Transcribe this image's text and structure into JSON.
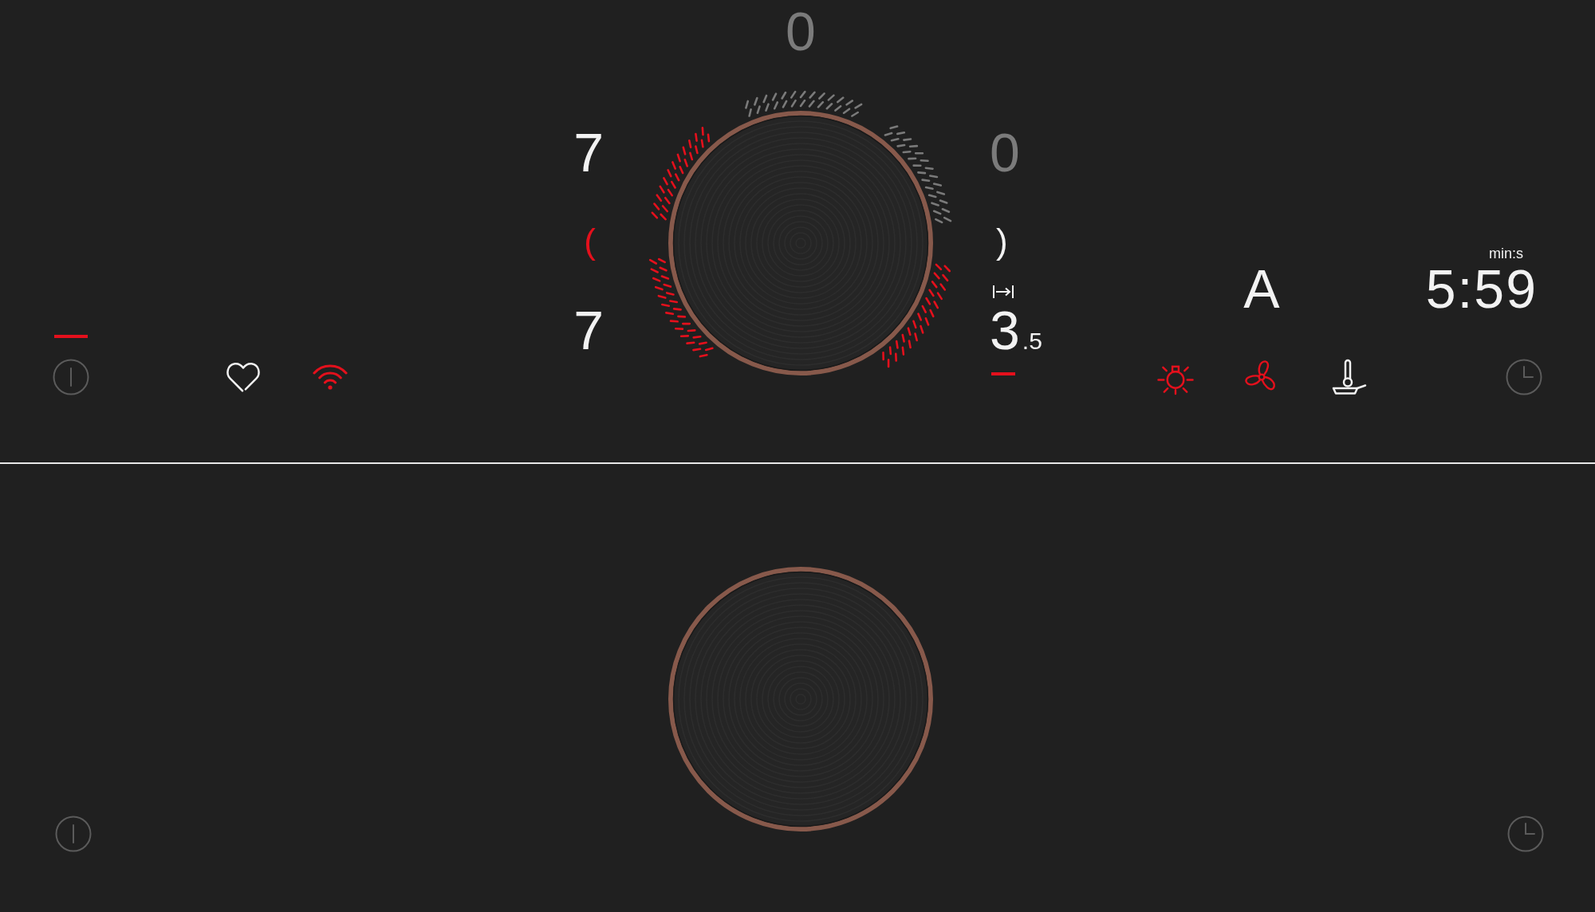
{
  "upper_hob": {
    "knob_display": {
      "text": "0",
      "on": false,
      "selected": false
    },
    "left_displays": [
      {
        "kind": "level",
        "text": "7",
        "on": true,
        "selected": false
      },
      {
        "kind": "bracket",
        "text": "(",
        "active": true
      },
      {
        "kind": "level",
        "text": "7",
        "on": true,
        "selected": false
      }
    ],
    "right_displays": [
      {
        "kind": "level",
        "text": "0",
        "on": false,
        "selected": false
      },
      {
        "kind": "bracket",
        "text": ")",
        "active": false
      },
      {
        "kind": "boost",
        "text": "3$_{.5}$",
        "on": true,
        "selected": true
      }
    ],
    "power_button": {
      "on": true
    },
    "favorite_button": {
      "active": false
    },
    "wifi_button": {
      "active": true
    },
    "mode_display": {
      "text": "A"
    },
    "timer_display": {
      "unit": "min:s",
      "text": "5:59"
    },
    "function_buttons": [
      {
        "kind": "light",
        "active": true
      },
      {
        "kind": "fan",
        "active": true
      },
      {
        "kind": "pan_sensor",
        "active": false
      }
    ]
  },
  "lower_hob": {
    "power_button": {
      "on": false
    }
  }
}
